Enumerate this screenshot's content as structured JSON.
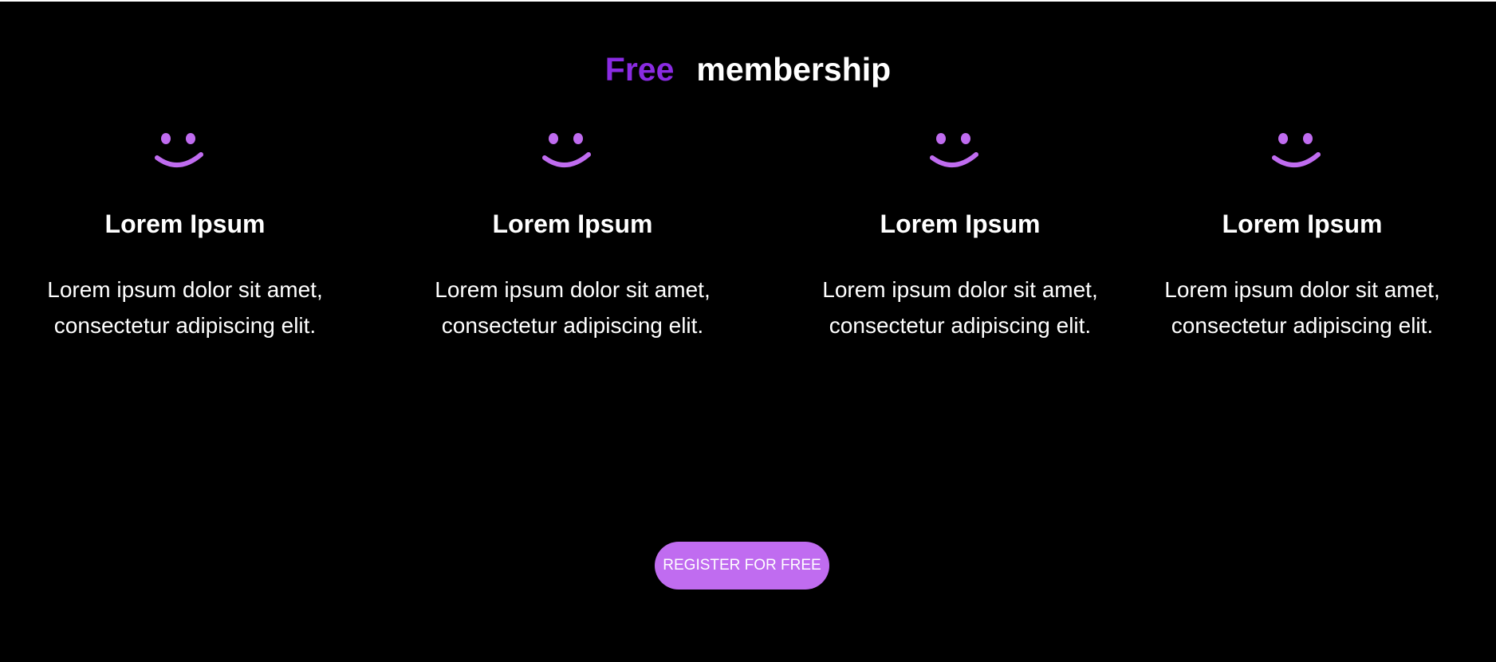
{
  "header": {
    "title_highlight": "Free",
    "title_rest": "membership"
  },
  "features": [
    {
      "icon": "smiley-icon",
      "title": "Lorem Ipsum",
      "desc_line1": "Lorem ipsum dolor sit amet,",
      "desc_line2": "consectetur adipiscing elit."
    },
    {
      "icon": "smiley-icon",
      "title": "Lorem Ipsum",
      "desc_line1": "Lorem ipsum dolor sit amet,",
      "desc_line2": "consectetur adipiscing elit."
    },
    {
      "icon": "smiley-icon",
      "title": "Lorem Ipsum",
      "desc_line1": "Lorem ipsum dolor sit amet,",
      "desc_line2": "consectetur adipiscing elit."
    },
    {
      "icon": "smiley-icon",
      "title": "Lorem Ipsum",
      "desc_line1": "Lorem ipsum dolor sit amet,",
      "desc_line2": "consectetur adipiscing elit."
    }
  ],
  "cta": {
    "register_label": "REGISTER FOR FREE"
  },
  "colors": {
    "background": "#000000",
    "accent_title": "#8a2be2",
    "icon": "#c06cf0",
    "button": "#c06cf0",
    "text": "#ffffff"
  }
}
